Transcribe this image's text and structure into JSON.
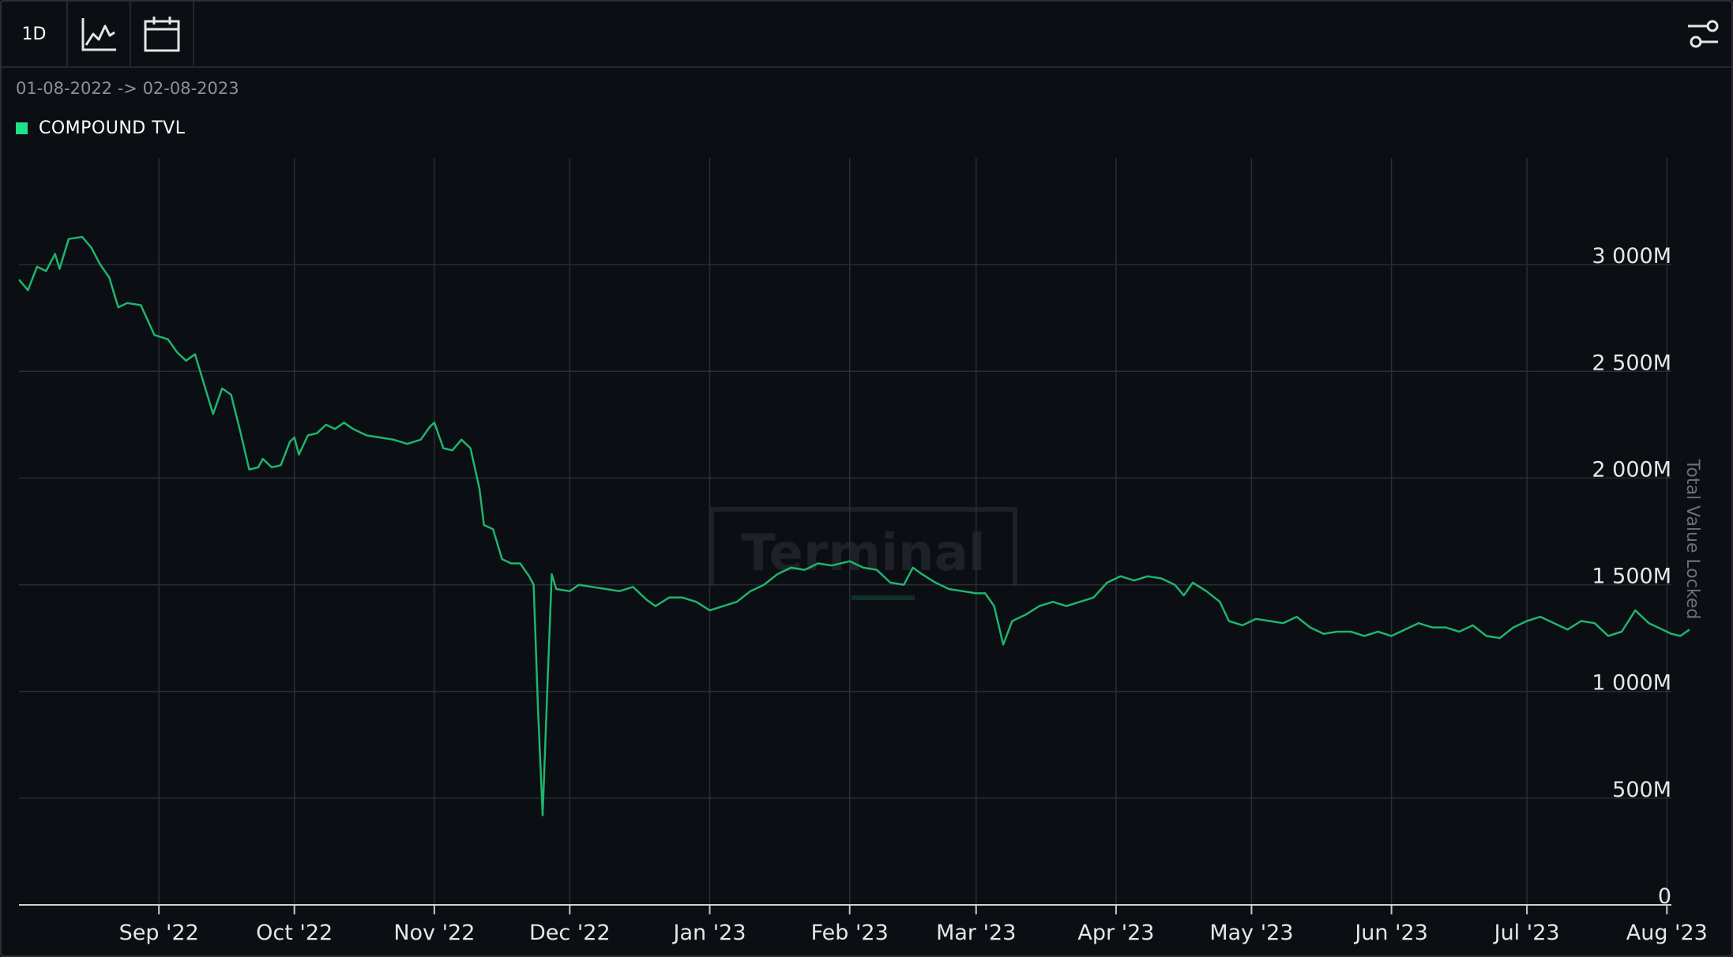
{
  "toolbar": {
    "interval_label": "1D",
    "icons": [
      "line-chart-icon",
      "calendar-icon",
      "sliders-settings-icon"
    ]
  },
  "date_range": "01-08-2022 -> 02-08-2023",
  "legend": {
    "label": "COMPOUND TVL",
    "color": "#1fe38a"
  },
  "watermark": "Terminal",
  "colors": {
    "background": "#0b0e13",
    "line": "#1fb56c",
    "grid": "#2a2e35"
  },
  "chart_data": {
    "type": "line",
    "series_name": "COMPOUND TVL",
    "ylabel": "Total Value Locked",
    "x_ticks": [
      "Sep '22",
      "Oct '22",
      "Nov '22",
      "Dec '22",
      "Jan '23",
      "Feb '23",
      "Mar '23",
      "Apr '23",
      "May '23",
      "Jun '23",
      "Jul '23",
      "Aug '23"
    ],
    "x_tick_dates": [
      "2022-09-01",
      "2022-10-01",
      "2022-11-01",
      "2022-12-01",
      "2023-01-01",
      "2023-02-01",
      "2023-03-01",
      "2023-04-01",
      "2023-05-01",
      "2023-06-01",
      "2023-07-01",
      "2023-08-01"
    ],
    "xlim": [
      "2022-08-01",
      "2023-08-02"
    ],
    "y_ticks": [
      {
        "value": 0,
        "label": "0"
      },
      {
        "value": 500,
        "label": "500M"
      },
      {
        "value": 1000,
        "label": "1 000M"
      },
      {
        "value": 1500,
        "label": "1 500M"
      },
      {
        "value": 2000,
        "label": "2 000M"
      },
      {
        "value": 2500,
        "label": "2 500M"
      },
      {
        "value": 3000,
        "label": "3 000M"
      }
    ],
    "ylim": [
      0,
      3500
    ],
    "y_unit": "M",
    "grid": true,
    "points": [
      [
        "2022-08-01",
        2930
      ],
      [
        "2022-08-03",
        2880
      ],
      [
        "2022-08-05",
        2990
      ],
      [
        "2022-08-07",
        2970
      ],
      [
        "2022-08-09",
        3050
      ],
      [
        "2022-08-10",
        2980
      ],
      [
        "2022-08-12",
        3120
      ],
      [
        "2022-08-15",
        3130
      ],
      [
        "2022-08-17",
        3080
      ],
      [
        "2022-08-19",
        3000
      ],
      [
        "2022-08-21",
        2940
      ],
      [
        "2022-08-23",
        2800
      ],
      [
        "2022-08-25",
        2820
      ],
      [
        "2022-08-28",
        2810
      ],
      [
        "2022-08-31",
        2670
      ],
      [
        "2022-09-03",
        2650
      ],
      [
        "2022-09-05",
        2590
      ],
      [
        "2022-09-07",
        2550
      ],
      [
        "2022-09-09",
        2580
      ],
      [
        "2022-09-11",
        2440
      ],
      [
        "2022-09-13",
        2300
      ],
      [
        "2022-09-15",
        2420
      ],
      [
        "2022-09-17",
        2390
      ],
      [
        "2022-09-19",
        2220
      ],
      [
        "2022-09-21",
        2040
      ],
      [
        "2022-09-23",
        2050
      ],
      [
        "2022-09-24",
        2090
      ],
      [
        "2022-09-26",
        2050
      ],
      [
        "2022-09-28",
        2060
      ],
      [
        "2022-09-30",
        2170
      ],
      [
        "2022-10-01",
        2190
      ],
      [
        "2022-10-02",
        2110
      ],
      [
        "2022-10-04",
        2200
      ],
      [
        "2022-10-06",
        2210
      ],
      [
        "2022-10-08",
        2250
      ],
      [
        "2022-10-10",
        2230
      ],
      [
        "2022-10-12",
        2260
      ],
      [
        "2022-10-14",
        2230
      ],
      [
        "2022-10-17",
        2200
      ],
      [
        "2022-10-20",
        2190
      ],
      [
        "2022-10-23",
        2180
      ],
      [
        "2022-10-26",
        2160
      ],
      [
        "2022-10-29",
        2180
      ],
      [
        "2022-10-31",
        2240
      ],
      [
        "2022-11-01",
        2260
      ],
      [
        "2022-11-03",
        2140
      ],
      [
        "2022-11-05",
        2130
      ],
      [
        "2022-11-07",
        2180
      ],
      [
        "2022-11-09",
        2140
      ],
      [
        "2022-11-11",
        1950
      ],
      [
        "2022-11-12",
        1780
      ],
      [
        "2022-11-14",
        1760
      ],
      [
        "2022-11-16",
        1620
      ],
      [
        "2022-11-18",
        1600
      ],
      [
        "2022-11-20",
        1600
      ],
      [
        "2022-11-22",
        1540
      ],
      [
        "2022-11-23",
        1500
      ],
      [
        "2022-11-24",
        900
      ],
      [
        "2022-11-25",
        420
      ],
      [
        "2022-11-26",
        1000
      ],
      [
        "2022-11-27",
        1550
      ],
      [
        "2022-11-28",
        1480
      ],
      [
        "2022-12-01",
        1470
      ],
      [
        "2022-12-03",
        1500
      ],
      [
        "2022-12-06",
        1490
      ],
      [
        "2022-12-09",
        1480
      ],
      [
        "2022-12-12",
        1470
      ],
      [
        "2022-12-15",
        1490
      ],
      [
        "2022-12-18",
        1430
      ],
      [
        "2022-12-20",
        1400
      ],
      [
        "2022-12-23",
        1440
      ],
      [
        "2022-12-26",
        1440
      ],
      [
        "2022-12-29",
        1420
      ],
      [
        "2023-01-01",
        1380
      ],
      [
        "2023-01-04",
        1400
      ],
      [
        "2023-01-07",
        1420
      ],
      [
        "2023-01-10",
        1470
      ],
      [
        "2023-01-13",
        1500
      ],
      [
        "2023-01-16",
        1550
      ],
      [
        "2023-01-19",
        1580
      ],
      [
        "2023-01-22",
        1570
      ],
      [
        "2023-01-25",
        1600
      ],
      [
        "2023-01-28",
        1590
      ],
      [
        "2023-02-01",
        1610
      ],
      [
        "2023-02-04",
        1580
      ],
      [
        "2023-02-07",
        1570
      ],
      [
        "2023-02-10",
        1510
      ],
      [
        "2023-02-13",
        1500
      ],
      [
        "2023-02-15",
        1580
      ],
      [
        "2023-02-17",
        1550
      ],
      [
        "2023-02-20",
        1510
      ],
      [
        "2023-02-23",
        1480
      ],
      [
        "2023-02-26",
        1470
      ],
      [
        "2023-03-01",
        1460
      ],
      [
        "2023-03-03",
        1460
      ],
      [
        "2023-03-05",
        1400
      ],
      [
        "2023-03-07",
        1220
      ],
      [
        "2023-03-09",
        1330
      ],
      [
        "2023-03-12",
        1360
      ],
      [
        "2023-03-15",
        1400
      ],
      [
        "2023-03-18",
        1420
      ],
      [
        "2023-03-21",
        1400
      ],
      [
        "2023-03-24",
        1420
      ],
      [
        "2023-03-27",
        1440
      ],
      [
        "2023-03-30",
        1510
      ],
      [
        "2023-04-02",
        1540
      ],
      [
        "2023-04-05",
        1520
      ],
      [
        "2023-04-08",
        1540
      ],
      [
        "2023-04-11",
        1530
      ],
      [
        "2023-04-14",
        1500
      ],
      [
        "2023-04-16",
        1450
      ],
      [
        "2023-04-18",
        1510
      ],
      [
        "2023-04-21",
        1470
      ],
      [
        "2023-04-24",
        1420
      ],
      [
        "2023-04-26",
        1330
      ],
      [
        "2023-04-29",
        1310
      ],
      [
        "2023-05-02",
        1340
      ],
      [
        "2023-05-05",
        1330
      ],
      [
        "2023-05-08",
        1320
      ],
      [
        "2023-05-11",
        1350
      ],
      [
        "2023-05-14",
        1300
      ],
      [
        "2023-05-17",
        1270
      ],
      [
        "2023-05-20",
        1280
      ],
      [
        "2023-05-23",
        1280
      ],
      [
        "2023-05-26",
        1260
      ],
      [
        "2023-05-29",
        1280
      ],
      [
        "2023-06-01",
        1260
      ],
      [
        "2023-06-04",
        1290
      ],
      [
        "2023-06-07",
        1320
      ],
      [
        "2023-06-10",
        1300
      ],
      [
        "2023-06-13",
        1300
      ],
      [
        "2023-06-16",
        1280
      ],
      [
        "2023-06-19",
        1310
      ],
      [
        "2023-06-22",
        1260
      ],
      [
        "2023-06-25",
        1250
      ],
      [
        "2023-06-28",
        1300
      ],
      [
        "2023-07-01",
        1330
      ],
      [
        "2023-07-04",
        1350
      ],
      [
        "2023-07-07",
        1320
      ],
      [
        "2023-07-10",
        1290
      ],
      [
        "2023-07-13",
        1330
      ],
      [
        "2023-07-16",
        1320
      ],
      [
        "2023-07-19",
        1260
      ],
      [
        "2023-07-22",
        1280
      ],
      [
        "2023-07-25",
        1380
      ],
      [
        "2023-07-28",
        1320
      ],
      [
        "2023-07-31",
        1290
      ],
      [
        "2023-08-02",
        1270
      ],
      [
        "2023-08-04",
        1260
      ],
      [
        "2023-08-06",
        1290
      ]
    ]
  }
}
